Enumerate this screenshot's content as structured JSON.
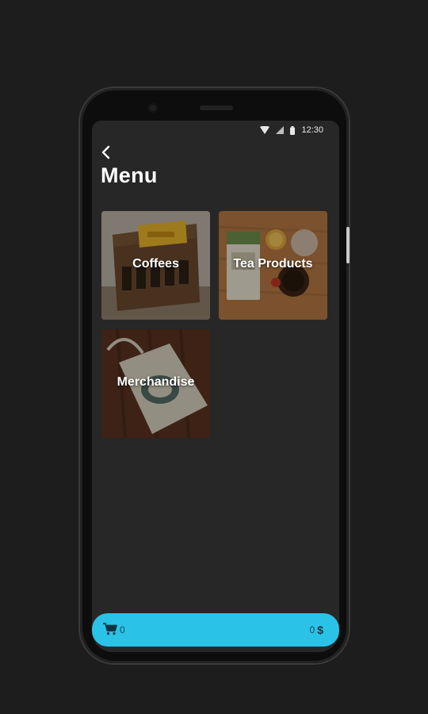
{
  "status_bar": {
    "time": "12:30"
  },
  "header": {
    "title": "Menu"
  },
  "categories": [
    {
      "label": "Coffees"
    },
    {
      "label": "Tea Products"
    },
    {
      "label": "Merchandise"
    }
  ],
  "cart": {
    "item_count": "0",
    "total": "0",
    "currency": "$"
  },
  "colors": {
    "accent": "#2bc2e8",
    "background": "#272727"
  }
}
